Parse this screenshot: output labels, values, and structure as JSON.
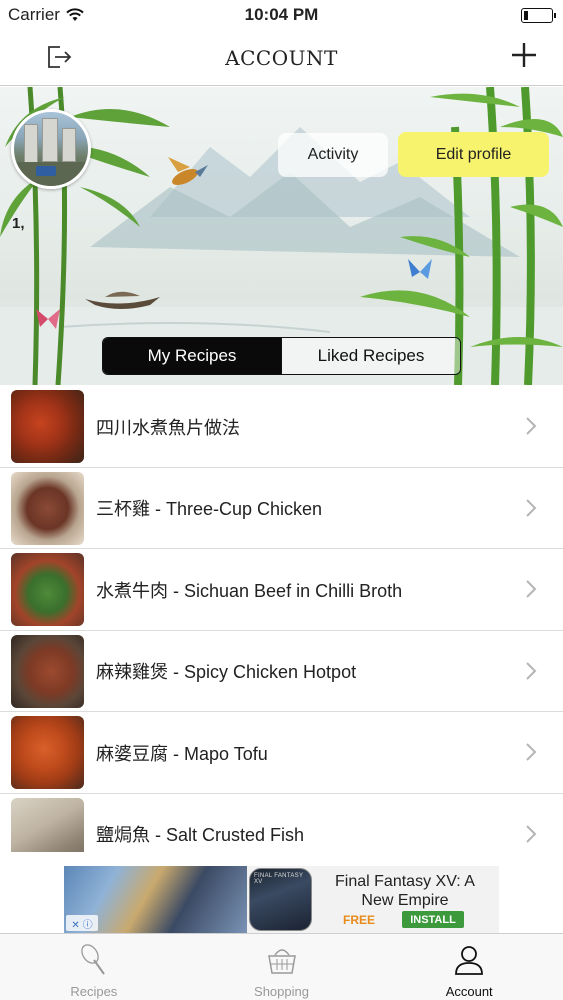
{
  "status_bar": {
    "carrier": "Carrier",
    "time": "10:04 PM",
    "battery_level": 0.15
  },
  "nav": {
    "title": "ACCOUNT",
    "left_icon": "logout-icon",
    "right_icon": "plus-icon"
  },
  "profile": {
    "name": "1,",
    "activity_label": "Activity",
    "edit_label": "Edit profile",
    "edit_color": "#f7f36d"
  },
  "segments": {
    "my_recipes": "My Recipes",
    "liked_recipes": "Liked Recipes",
    "selected": "My Recipes"
  },
  "recipes": [
    {
      "title": "四川水煮魚片做法"
    },
    {
      "title": "三杯雞 - Three-Cup Chicken"
    },
    {
      "title": "水煮牛肉 - Sichuan Beef in Chilli Broth"
    },
    {
      "title": "麻辣雞煲 - Spicy Chicken Hotpot"
    },
    {
      "title": "麻婆豆腐 - Mapo Tofu"
    },
    {
      "title": "鹽焗魚 - Salt Crusted Fish"
    }
  ],
  "ad": {
    "title": "Final Fantasy XV: A New Empire",
    "price": "FREE",
    "install_label": "INSTALL",
    "icon_text": "FINAL FANTASY XV",
    "install_color": "#3c9a3c"
  },
  "tabs": [
    {
      "label": "Recipes",
      "icon": "whisk-icon",
      "active": false
    },
    {
      "label": "Shopping",
      "icon": "basket-icon",
      "active": false
    },
    {
      "label": "Account",
      "icon": "person-icon",
      "active": true
    }
  ]
}
